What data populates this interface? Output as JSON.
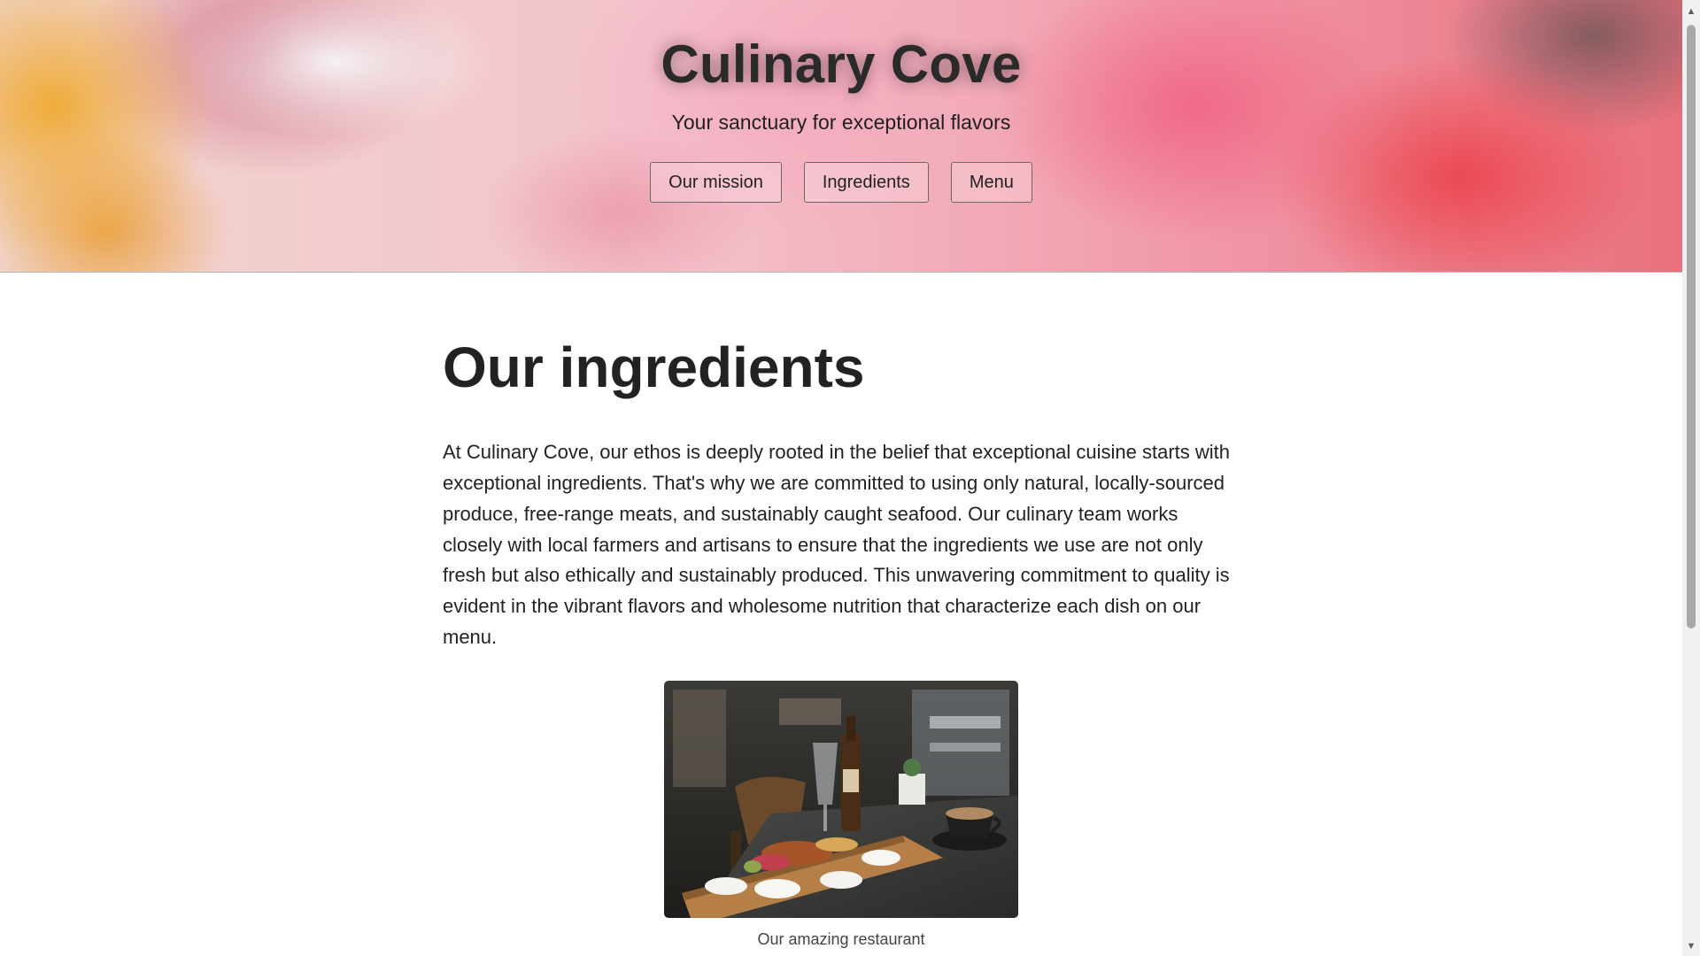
{
  "hero": {
    "title": "Culinary Cove",
    "subtitle": "Your sanctuary for exceptional flavors",
    "nav": [
      {
        "label": "Our mission"
      },
      {
        "label": "Ingredients"
      },
      {
        "label": "Menu"
      }
    ]
  },
  "main": {
    "heading": "Our ingredients",
    "body": "At Culinary Cove, our ethos is deeply rooted in the belief that exceptional cuisine starts with exceptional ingredients. That's why we are committed to using only natural, locally-sourced produce, free-range meats, and sustainably caught seafood. Our culinary team works closely with local farmers and artisans to ensure that the ingredients we use are not only fresh but also ethically and sustainably produced. This unwavering commitment to quality is evident in the vibrant flavors and wholesome nutrition that characterize each dish on our menu.",
    "figure": {
      "caption": "Our amazing restaurant"
    }
  },
  "scrollbar": {
    "up_icon": "chevron-up-icon",
    "down_icon": "chevron-down-icon"
  }
}
